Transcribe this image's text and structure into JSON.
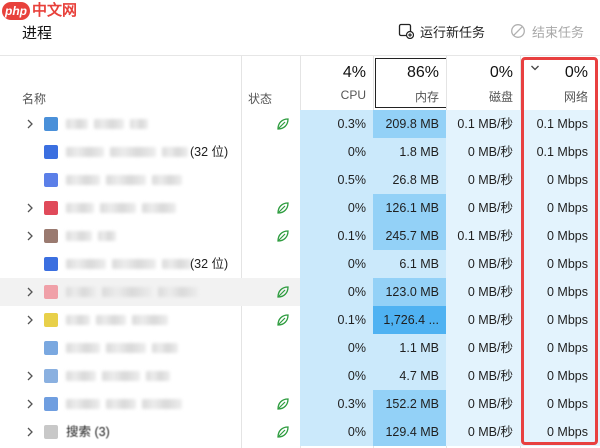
{
  "watermark": {
    "brand": "php",
    "text": "中文网"
  },
  "page_title": "进程",
  "toolbar": {
    "run_new_task": "运行新任务",
    "end_task": "结束任务"
  },
  "columns": {
    "name": "名称",
    "status": "状态",
    "cpu": {
      "percent": "4%",
      "label": "CPU"
    },
    "memory": {
      "percent": "86%",
      "label": "内存"
    },
    "disk": {
      "percent": "0%",
      "label": "磁盘"
    },
    "network": {
      "percent": "0%",
      "label": "网络",
      "sort_indicator": "chevron-down"
    }
  },
  "colors": {
    "cpu_cell": "#cbe9fb",
    "memory_cell": "#cbe9fb",
    "memory_mid": "#93d1f7",
    "memory_high": "#4fb2f2",
    "disk_cell": "#e3f3fd",
    "network_cell": "#e3f3fd",
    "highlight_outline": "#e84040",
    "status_leaf": "#2e9c3f"
  },
  "rows": [
    {
      "expandable": true,
      "icon_color": "#4a90d9",
      "suffix": "",
      "eco": true,
      "cpu": "0.3%",
      "memory": "209.8 MB",
      "mem_level": 2,
      "disk": "0.1 MB/秒",
      "network": "0.1 Mbps"
    },
    {
      "expandable": false,
      "icon_color": "#3b6fe0",
      "suffix": "(32 位)",
      "eco": false,
      "cpu": "0%",
      "memory": "1.8 MB",
      "mem_level": 1,
      "disk": "0 MB/秒",
      "network": "0.1 Mbps"
    },
    {
      "expandable": false,
      "icon_color": "#5b7fe8",
      "suffix": "",
      "eco": false,
      "cpu": "0.5%",
      "memory": "26.8 MB",
      "mem_level": 1,
      "disk": "0 MB/秒",
      "network": "0 Mbps"
    },
    {
      "expandable": true,
      "icon_color": "#e04a5a",
      "suffix": "",
      "eco": true,
      "cpu": "0%",
      "memory": "126.1 MB",
      "mem_level": 2,
      "disk": "0 MB/秒",
      "network": "0 Mbps"
    },
    {
      "expandable": true,
      "icon_color": "#9a7a70",
      "suffix": "",
      "eco": true,
      "cpu": "0.1%",
      "memory": "245.7 MB",
      "mem_level": 2,
      "disk": "0.1 MB/秒",
      "network": "0 Mbps"
    },
    {
      "expandable": false,
      "icon_color": "#3b6fe0",
      "suffix": "(32 位)",
      "eco": false,
      "cpu": "0%",
      "memory": "6.1 MB",
      "mem_level": 1,
      "disk": "0 MB/秒",
      "network": "0 Mbps"
    },
    {
      "expandable": true,
      "icon_color": "#f0a0a8",
      "suffix": "",
      "eco": true,
      "highlight": true,
      "cpu": "0%",
      "memory": "123.0 MB",
      "mem_level": 2,
      "disk": "0 MB/秒",
      "network": "0 Mbps"
    },
    {
      "expandable": true,
      "icon_color": "#e8d04a",
      "suffix": "",
      "eco": true,
      "cpu": "0.1%",
      "memory": "1,726.4 ...",
      "mem_level": 3,
      "disk": "0 MB/秒",
      "network": "0 Mbps"
    },
    {
      "expandable": false,
      "icon_color": "#7aa8e0",
      "suffix": "",
      "eco": false,
      "cpu": "0%",
      "memory": "1.1 MB",
      "mem_level": 1,
      "disk": "0 MB/秒",
      "network": "0 Mbps"
    },
    {
      "expandable": true,
      "icon_color": "#8ab0e0",
      "suffix": "",
      "eco": false,
      "cpu": "0%",
      "memory": "4.7 MB",
      "mem_level": 1,
      "disk": "0 MB/秒",
      "network": "0 Mbps"
    },
    {
      "expandable": true,
      "icon_color": "#6f9ee0",
      "suffix": "",
      "eco": true,
      "cpu": "0.3%",
      "memory": "152.2 MB",
      "mem_level": 2,
      "disk": "0 MB/秒",
      "network": "0 Mbps"
    },
    {
      "expandable": true,
      "icon_color": "#c8c8c8",
      "suffix": "",
      "name_visible": "搜索 (3)",
      "eco": true,
      "cpu": "0%",
      "memory": "129.4 MB",
      "mem_level": 2,
      "disk": "0 MB/秒",
      "network": "0 Mbps"
    }
  ]
}
